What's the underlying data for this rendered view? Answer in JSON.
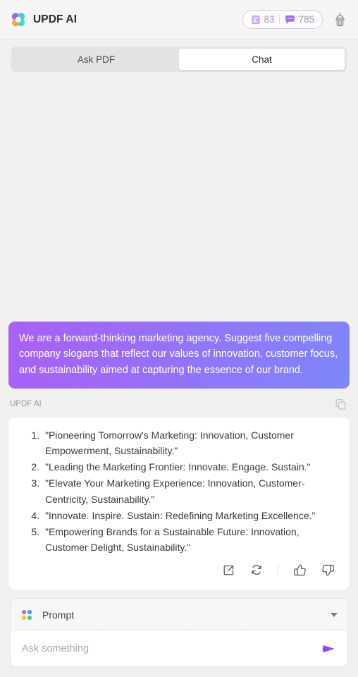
{
  "header": {
    "brand_name": "UPDF AI",
    "logo_icon": "updf-clover-logo",
    "counters": [
      {
        "icon": "document-icon",
        "value": "83"
      },
      {
        "icon": "chat-bubble-icon",
        "value": "785"
      }
    ],
    "clear_icon": "broom-icon"
  },
  "tabs": [
    {
      "label": "Ask PDF",
      "active": false
    },
    {
      "label": "Chat",
      "active": true
    }
  ],
  "conversation": {
    "user_message": "We are a forward-thinking marketing agency. Suggest five compelling company slogans that reflect our values of innovation, customer focus, and sustainability aimed at capturing the essence of our brand.",
    "ai_label": "UPDF AI",
    "copy_icon": "copy-icon",
    "ai_items": [
      "\"Pioneering Tomorrow's Marketing: Innovation, Customer Empowerment, Sustainability.\"",
      "\"Leading the Marketing Frontier: Innovate. Engage. Sustain.\"",
      "\"Elevate Your Marketing Experience: Innovation, Customer-Centricity, Sustainability.\"",
      "\"Innovate. Inspire. Sustain: Redefining Marketing Excellence.\"",
      "\"Empowering Brands for a Sustainable Future: Innovation, Customer Delight, Sustainability.\""
    ],
    "actions": [
      {
        "name": "share-icon"
      },
      {
        "name": "refresh-icon"
      },
      {
        "name": "thumbs-up-icon"
      },
      {
        "name": "thumbs-down-icon"
      }
    ]
  },
  "composer": {
    "prompt_label": "Prompt",
    "prompt_icon": "four-dots-icon",
    "caret_icon": "chevron-down-icon",
    "input_value": "",
    "input_placeholder": "Ask something",
    "send_icon": "send-arrow-icon"
  },
  "colors": {
    "page_bg": "#f0f0f0",
    "accent_purple": "#a95ff5",
    "accent_blue": "#7e86fb",
    "send_purple": "#8b4ef0",
    "pill_border": "#d9c6f5"
  }
}
